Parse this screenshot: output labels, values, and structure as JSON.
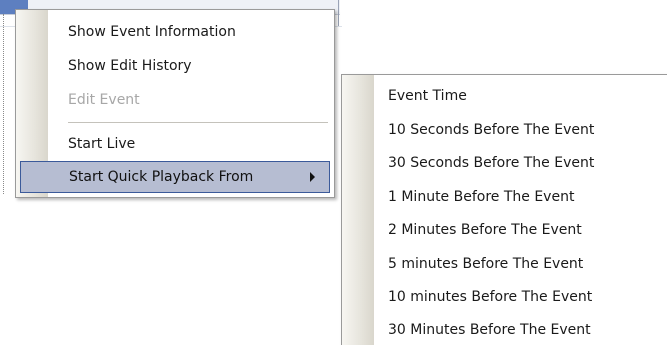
{
  "context_menu": {
    "items": [
      {
        "label": "Show Event Information",
        "enabled": true
      },
      {
        "label": "Show Edit History",
        "enabled": true
      },
      {
        "label": "Edit Event",
        "enabled": false
      },
      {
        "label": "Start Live",
        "enabled": true
      },
      {
        "label": "Start Quick Playback From",
        "enabled": true,
        "highlighted": true,
        "has_submenu": true
      }
    ]
  },
  "submenu": {
    "items": [
      {
        "label": "Event Time"
      },
      {
        "label": "10 Seconds Before The Event"
      },
      {
        "label": "30 Seconds Before The Event"
      },
      {
        "label": "1 Minute Before The Event"
      },
      {
        "label": "2 Minutes Before The Event"
      },
      {
        "label": "5 minutes Before The Event"
      },
      {
        "label": "10 minutes Before The Event"
      },
      {
        "label": "30 Minutes Before The Event"
      }
    ]
  },
  "colors": {
    "highlight_bg": "#b6bdd2",
    "highlight_border": "#3b5a9a",
    "disabled_text": "#a7a7a7"
  }
}
